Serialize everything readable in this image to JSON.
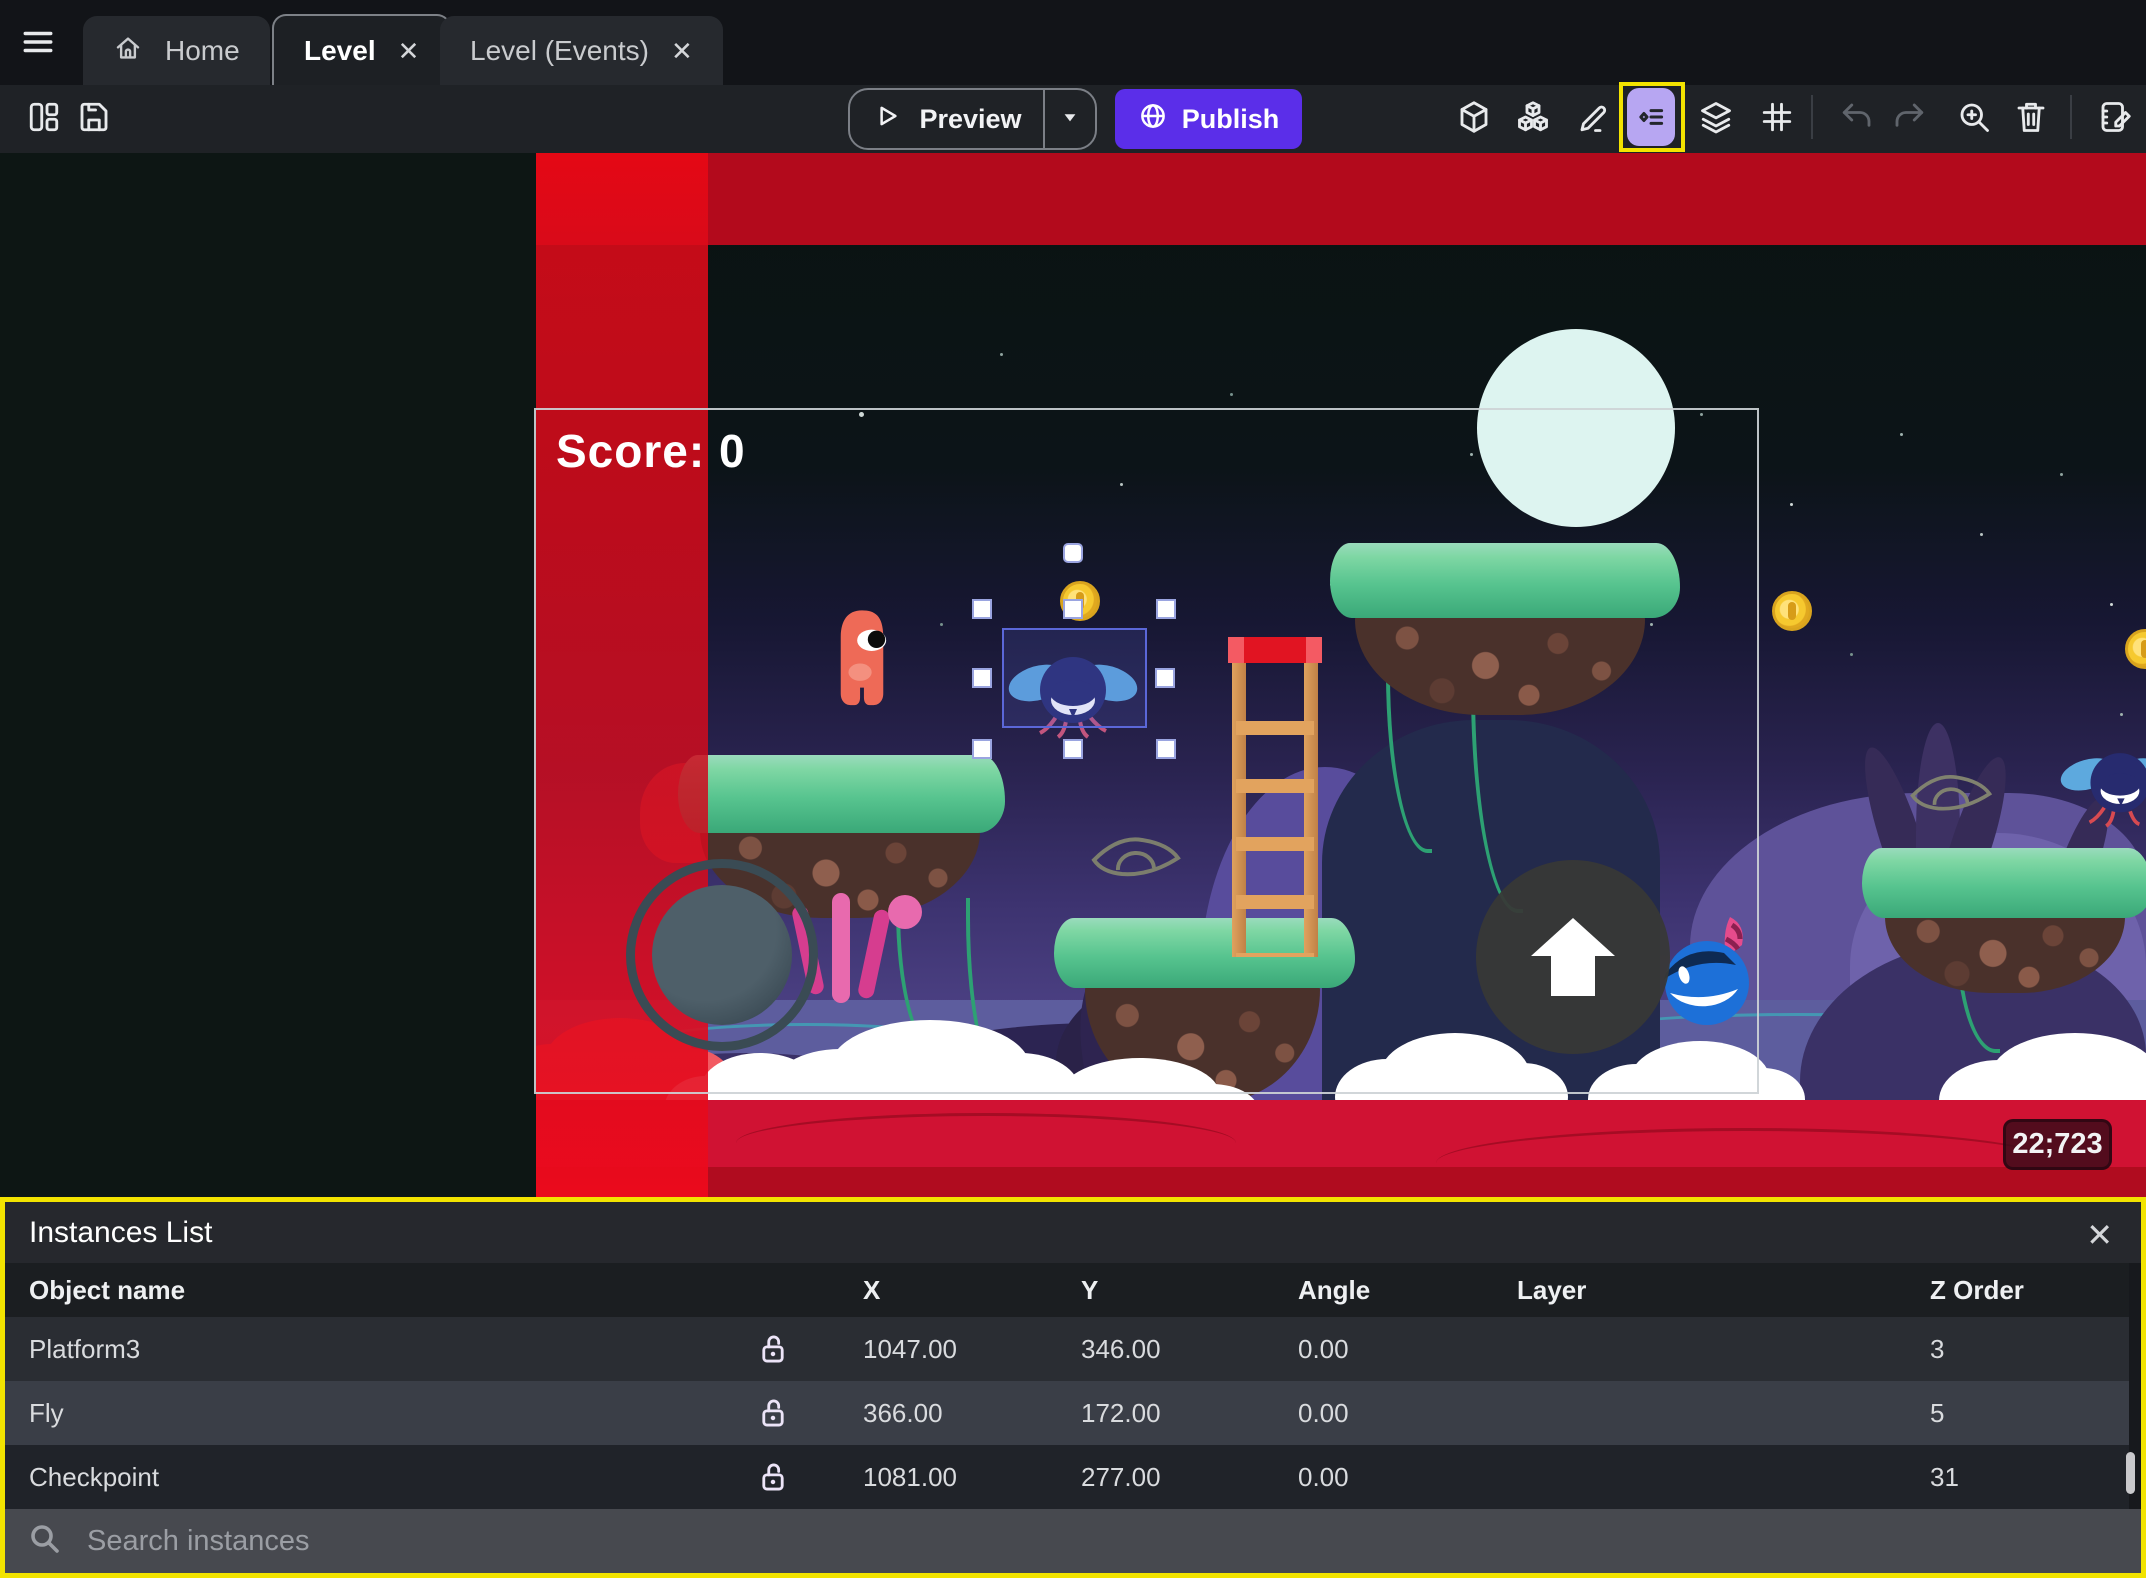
{
  "tabbar": {
    "tabs": [
      {
        "label": "Home"
      },
      {
        "label": "Level"
      },
      {
        "label": "Level (Events)"
      }
    ],
    "close_glyph": "✕"
  },
  "toolbar": {
    "preview_label": "Preview",
    "publish_label": "Publish",
    "icons": [
      "panels-layout",
      "save",
      "3d-box",
      "objects-stack",
      "edit-pencil",
      "instances-list",
      "layers",
      "grid",
      "undo",
      "redo",
      "zoom-in",
      "trash",
      "scene-editor"
    ]
  },
  "canvas": {
    "score_text": "Score: 0",
    "coords_badge": "22;723",
    "selected_instance": "Fly"
  },
  "panel": {
    "title": "Instances List",
    "columns": [
      "Object name",
      "X",
      "Y",
      "Angle",
      "Layer",
      "Z Order"
    ],
    "rows": [
      {
        "name": "Platform3",
        "x": "1047.00",
        "y": "346.00",
        "angle": "0.00",
        "layer": "",
        "z": "3"
      },
      {
        "name": "Fly",
        "x": "366.00",
        "y": "172.00",
        "angle": "0.00",
        "layer": "",
        "z": "5"
      },
      {
        "name": "Checkpoint",
        "x": "1081.00",
        "y": "277.00",
        "angle": "0.00",
        "layer": "",
        "z": "31"
      }
    ],
    "search_placeholder": "Search instances",
    "lock_icon": "lock-open"
  },
  "colors": {
    "accent_purple": "#5b2ee9",
    "highlight_yellow": "#f2e300",
    "instances_icon_bg": "#b7a6f2",
    "danger_red_zone": "#c40d24",
    "selection_blue": "#5b67d8",
    "chrome_dark": "#1f2226"
  }
}
